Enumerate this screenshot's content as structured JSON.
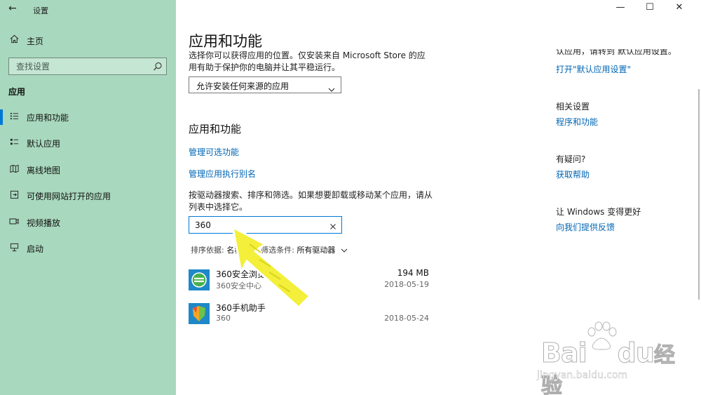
{
  "window": {
    "title": "设置",
    "back_glyph": "←",
    "controls": {
      "minimize": "—",
      "maximize": "☐",
      "close": "✕"
    }
  },
  "sidebar": {
    "home": {
      "label": "主页",
      "icon": "home-icon"
    },
    "search": {
      "placeholder": "查找设置",
      "value": ""
    },
    "section": "应用",
    "items": [
      {
        "label": "应用和功能",
        "icon": "apps-features-icon",
        "active": true
      },
      {
        "label": "默认应用",
        "icon": "default-apps-icon",
        "active": false
      },
      {
        "label": "离线地图",
        "icon": "offline-maps-icon",
        "active": false
      },
      {
        "label": "可使用网站打开的应用",
        "icon": "apps-for-websites-icon",
        "active": false
      },
      {
        "label": "视频播放",
        "icon": "video-playback-icon",
        "active": false
      },
      {
        "label": "启动",
        "icon": "startup-icon",
        "active": false
      }
    ]
  },
  "main": {
    "title": "应用和功能",
    "intro": "选择你可以获得应用的位置。仅安装来自 Microsoft Store 的应用有助于保护你的电脑并让其平稳运行。",
    "install_source": {
      "value": "允许安装任何来源的应用"
    },
    "section_title": "应用和功能",
    "links": [
      "管理可选功能",
      "管理应用执行别名"
    ],
    "search_desc": "按驱动器搜索、排序和筛选。如果想要卸载或移动某个应用，请从列表中选择它。",
    "app_search": {
      "value": "360"
    },
    "sort": {
      "label": "排序依据:",
      "value": "名称"
    },
    "filter": {
      "label": "筛选条件:",
      "value": "所有驱动器"
    },
    "apps": [
      {
        "name": "360安全浏览器",
        "publisher": "360安全中心",
        "size": "194 MB",
        "date": "2018-05-19",
        "icon": "360-browser-icon"
      },
      {
        "name": "360手机助手",
        "publisher": "360",
        "size": "",
        "date": "2018-05-24",
        "icon": "360-phone-assistant-icon"
      }
    ]
  },
  "right": {
    "clipped_text": "认应用，请转到 默认应用设置。",
    "default_apps_link": "打开\"默认应用设置\"",
    "related_title": "相关设置",
    "related_link": "程序和功能",
    "question_title": "有疑问?",
    "help_link": "获取帮助",
    "feedback_title": "让 Windows 变得更好",
    "feedback_link": "向我们提供反馈"
  },
  "watermark": {
    "brand": "Bai",
    "brand2": "du",
    "brand3": "经验",
    "url": "jingyan.baidu.com"
  },
  "colors": {
    "sidebar_bg": "#a8d8bd",
    "accent": "#0078d7",
    "link": "#0066b4",
    "arrow": "#f3ef3a"
  }
}
